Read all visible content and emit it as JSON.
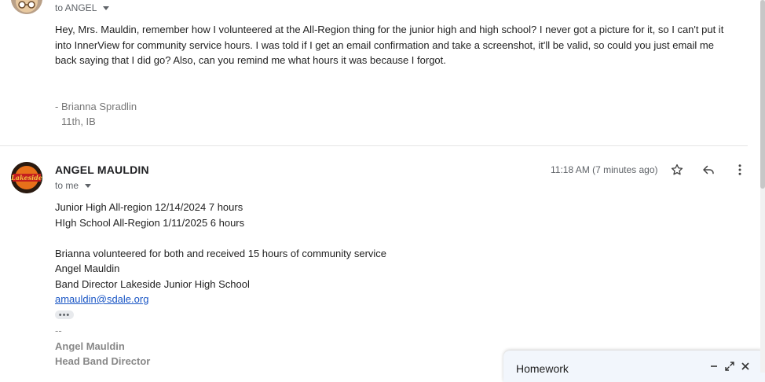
{
  "message1": {
    "to_label": "to ANGEL",
    "body_lines": [
      "Hey, Mrs. Mauldin, remember how I volunteered at the All-Region thing for the junior high and high school? I never got a picture for it, so I can't put it",
      "into InnerView for community service hours. I was told if I get an email confirmation and take a screenshot, it'll be valid, so could you just email me",
      "back saying that I did go? Also, can you remind me what hours it was because I forgot."
    ],
    "signature_name": "- Brianna Spradlin",
    "signature_class": "11th, IB"
  },
  "message2": {
    "sender": "ANGEL MAULDIN",
    "avatar_text": "Lakeside",
    "timestamp": "11:18 AM (7 minutes ago)",
    "to_label": "to me",
    "lines": [
      "Junior High All-region 12/14/2024 7 hours",
      "HIgh School All-Region 1/11/2025 6 hours",
      "",
      "Brianna volunteered for both and received 15 hours of community service",
      "Angel Mauldin",
      "Band Director Lakeside Junior High School"
    ],
    "email_link": "amauldin@sdale.org",
    "ellipsis": "•••",
    "sig_dash": "--",
    "sig_name": "Angel Mauldin",
    "sig_title": "Head Band Director"
  },
  "icons": {
    "star": "star-icon",
    "reply": "reply-icon",
    "more": "more-vert-icon",
    "minimize": "minimize-icon",
    "expand": "expand-icon",
    "close": "close-icon"
  },
  "compose": {
    "title": "Homework"
  }
}
